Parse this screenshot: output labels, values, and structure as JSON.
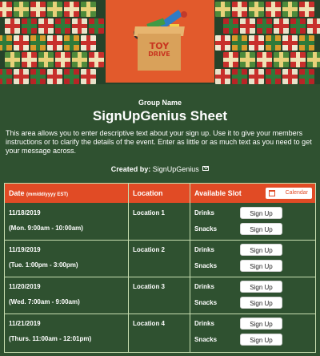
{
  "banner": {
    "logo": {
      "line1": "TOY",
      "line2": "DRIVE"
    }
  },
  "header": {
    "group_name": "Group Name",
    "title": "SignUpGenius Sheet",
    "description": "This area allows you to enter descriptive text about your sign up. Use it to give your members instructions or to clarify the details of the event. Enter as little or as much text as you need to get your message across.",
    "created_label": "Created by:",
    "created_by": "SignUpGenius"
  },
  "table": {
    "col_date": "Date",
    "col_date_hint": "(mm/dd/yyyy EST)",
    "col_location": "Location",
    "col_slot": "Available Slot",
    "calendar_label": "Calendar",
    "signup_label": "Sign Up",
    "rows": [
      {
        "date": "11/18/2019",
        "time": "(Mon. 9:00am - 10:00am)",
        "location": "Location 1",
        "slots": [
          "Drinks",
          "Snacks"
        ]
      },
      {
        "date": "11/19/2019",
        "time": "(Tue. 1:00pm - 3:00pm)",
        "location": "Location 2",
        "slots": [
          "Drinks",
          "Snacks"
        ]
      },
      {
        "date": "11/20/2019",
        "time": "(Wed. 7:00am - 9:00am)",
        "location": "Location 3",
        "slots": [
          "Drinks",
          "Snacks"
        ]
      },
      {
        "date": "11/21/2019",
        "time": "(Thurs. 11:00am - 12:01pm)",
        "location": "Location 4",
        "slots": [
          "Drinks",
          "Snacks"
        ]
      }
    ]
  },
  "colors": {
    "background": "#2f5130",
    "header_bar": "#e14b25",
    "logo_bg": "#e25a2c",
    "grid_line": "#c7ddb0"
  }
}
